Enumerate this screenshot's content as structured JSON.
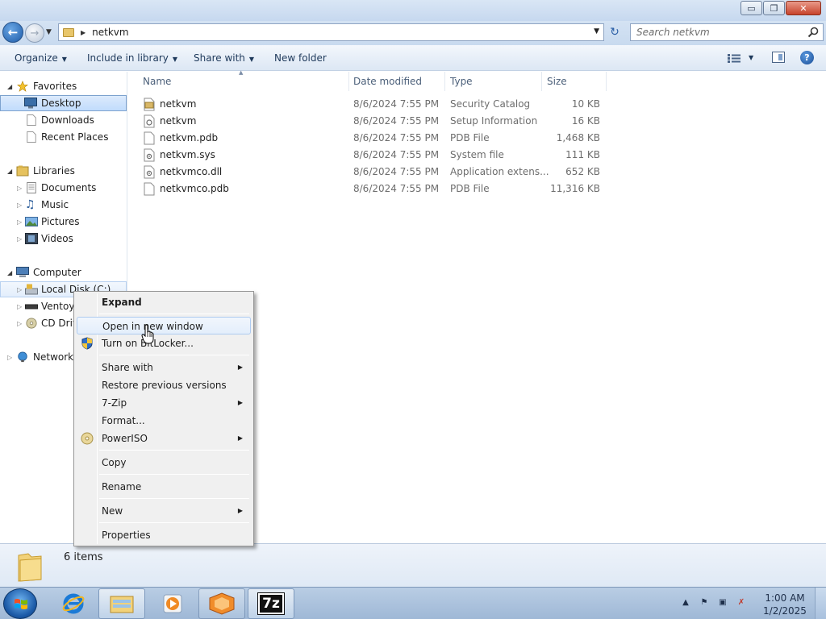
{
  "window": {
    "minimize_symbol": "▭",
    "maximize_symbol": "❐",
    "close_symbol": "✕"
  },
  "address": {
    "path_segment": "netkvm",
    "search_placeholder": "Search netkvm"
  },
  "toolbar": {
    "organize": "Organize",
    "include_in_library": "Include in library",
    "share_with": "Share with",
    "new_folder": "New folder"
  },
  "nav": {
    "favorites": "Favorites",
    "desktop": "Desktop",
    "downloads": "Downloads",
    "recent_places": "Recent Places",
    "libraries": "Libraries",
    "documents": "Documents",
    "music": "Music",
    "pictures": "Pictures",
    "videos": "Videos",
    "computer": "Computer",
    "local_disk": "Local Disk (C:)",
    "ventoy": "Ventoy",
    "cd_drive": "CD Drive",
    "network": "Network"
  },
  "columns": {
    "name": "Name",
    "date_modified": "Date modified",
    "type": "Type",
    "size": "Size"
  },
  "files": [
    {
      "name": "netkvm",
      "date": "8/6/2024 7:55 PM",
      "type": "Security Catalog",
      "size": "10 KB",
      "icon": "catalog-file"
    },
    {
      "name": "netkvm",
      "date": "8/6/2024 7:55 PM",
      "type": "Setup Information",
      "size": "16 KB",
      "icon": "setup-info-file"
    },
    {
      "name": "netkvm.pdb",
      "date": "8/6/2024 7:55 PM",
      "type": "PDB File",
      "size": "1,468 KB",
      "icon": "blank-file"
    },
    {
      "name": "netkvm.sys",
      "date": "8/6/2024 7:55 PM",
      "type": "System file",
      "size": "111 KB",
      "icon": "system-file"
    },
    {
      "name": "netkvmco.dll",
      "date": "8/6/2024 7:55 PM",
      "type": "Application extens...",
      "size": "652 KB",
      "icon": "dll-file"
    },
    {
      "name": "netkvmco.pdb",
      "date": "8/6/2024 7:55 PM",
      "type": "PDB File",
      "size": "11,316 KB",
      "icon": "blank-file"
    }
  ],
  "status": {
    "items_count": "6 items"
  },
  "context_menu": {
    "expand": "Expand",
    "open_new_window": "Open in new window",
    "bitlocker": "Turn on BitLocker...",
    "share_with": "Share with",
    "restore_previous": "Restore previous versions",
    "seven_zip": "7-Zip",
    "format": "Format...",
    "poweriso": "PowerISO",
    "copy": "Copy",
    "rename": "Rename",
    "new": "New",
    "properties": "Properties"
  },
  "taskbar": {
    "time": "1:00 AM",
    "date": "1/2/2025",
    "seven_zip_label": "7z"
  },
  "colors": {
    "selection": "#cce4fc",
    "menu_bg": "#f0f0f0",
    "taskbar": "#a9c2de"
  }
}
